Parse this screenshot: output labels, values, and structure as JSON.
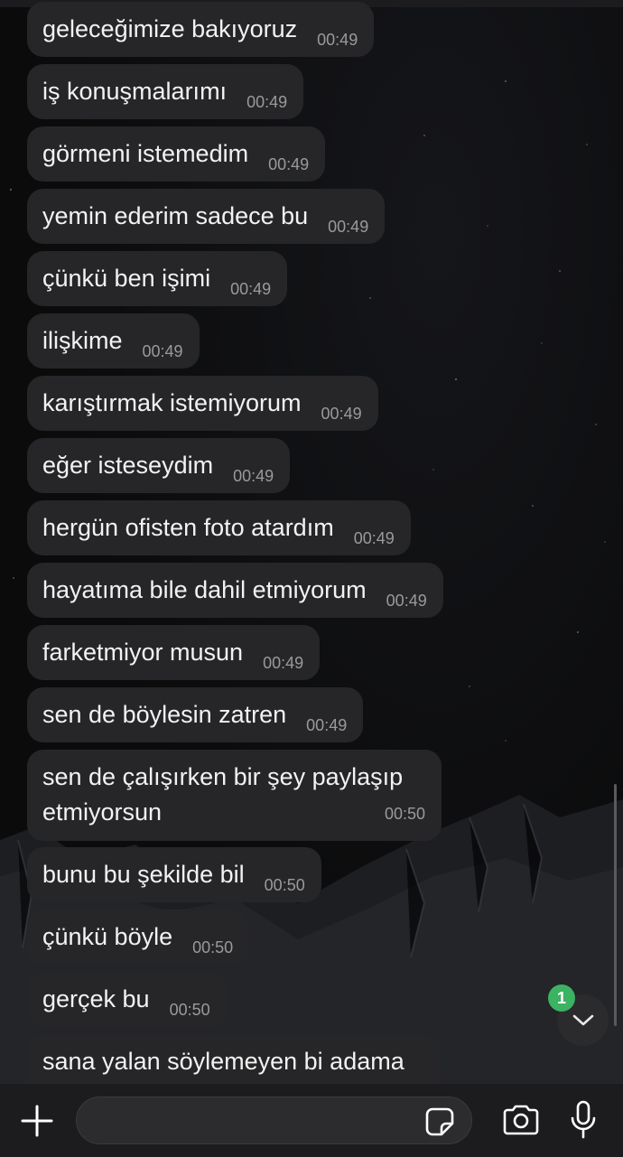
{
  "messages": [
    {
      "text": "geleceğimize bakıyoruz",
      "time": "00:49"
    },
    {
      "text": "iş konuşmalarımı",
      "time": "00:49"
    },
    {
      "text": "görmeni istemedim",
      "time": "00:49"
    },
    {
      "text": "yemin ederim sadece bu",
      "time": "00:49"
    },
    {
      "text": "çünkü ben işimi",
      "time": "00:49"
    },
    {
      "text": "ilişkime",
      "time": "00:49"
    },
    {
      "text": "karıştırmak istemiyorum",
      "time": "00:49"
    },
    {
      "text": "eğer isteseydim",
      "time": "00:49"
    },
    {
      "text": "hergün ofisten foto atardım",
      "time": "00:49"
    },
    {
      "text": "hayatıma bile dahil etmiyorum",
      "time": "00:49"
    },
    {
      "text": "farketmiyor musun",
      "time": "00:49"
    },
    {
      "text": "sen de böylesin zatren",
      "time": "00:49"
    },
    {
      "text": "sen de çalışırken bir şey paylaşıp etmiyorsun",
      "time": "00:50"
    },
    {
      "text": "bunu bu şekilde bil",
      "time": "00:50"
    },
    {
      "text": "çünkü böyle",
      "time": "00:50"
    },
    {
      "text": "gerçek bu",
      "time": "00:50"
    },
    {
      "text": "sana yalan söylemeyen bi adama",
      "time": ""
    }
  ],
  "unread_badge": "1",
  "composer": {
    "placeholder": ""
  },
  "icons": {
    "add": "plus-icon",
    "sticker": "sticker-icon",
    "camera": "camera-icon",
    "mic": "microphone-icon",
    "scroll": "chevron-down-icon"
  },
  "colors": {
    "bubble": "#262628",
    "badge": "#3cb263",
    "background": "#0b0b0c"
  }
}
